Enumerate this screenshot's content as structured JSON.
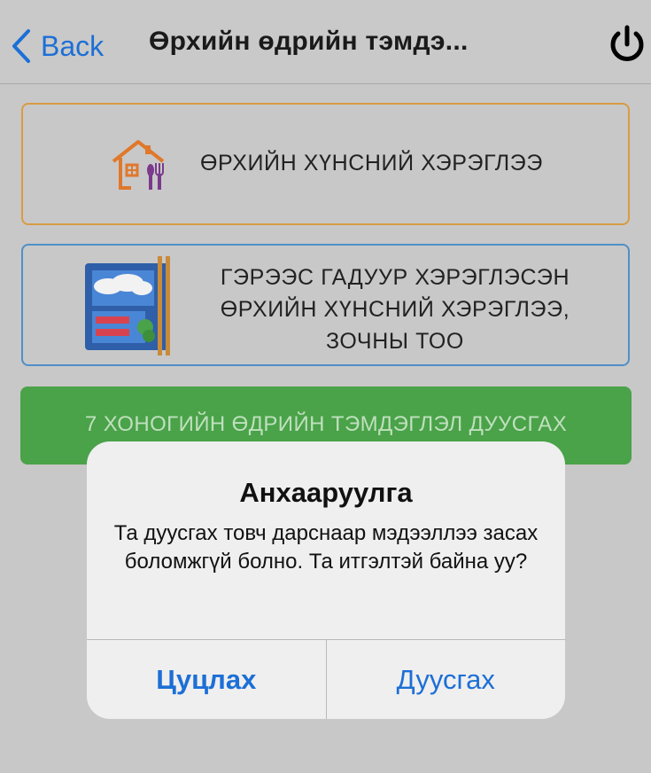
{
  "nav": {
    "back_label": "Back",
    "title": "Өрхийн өдрийн тэмдэ..."
  },
  "cards": [
    {
      "label": "ӨРХИЙН ХҮНСНИЙ ХЭРЭГЛЭЭ",
      "icon": "house-utensils-icon",
      "border_color": "#d99b43"
    },
    {
      "label": "ГЭРЭЭС ГАДУУР ХЭРЭГЛЭСЭН ӨРХИЙН ХҮНСНИЙ ХЭРЭГЛЭЭ, ЗОЧНЫ ТОО",
      "icon": "food-tray-chopsticks-icon",
      "border_color": "#4f8fc8"
    }
  ],
  "finish_button": {
    "label": "7 ХОНОГИЙН ӨДРИЙН ТЭМДЭГЛЭЛ ДУУСГАХ",
    "color": "#4aa249"
  },
  "alert": {
    "title": "Анхааруулга",
    "message": "Та дуусгах товч дарснаар мэдээллээ засах боломжгүй болно. Та итгэлтэй байна уу?",
    "cancel_label": "Цуцлах",
    "confirm_label": "Дуусгах"
  },
  "colors": {
    "accent": "#1c6fd6"
  }
}
